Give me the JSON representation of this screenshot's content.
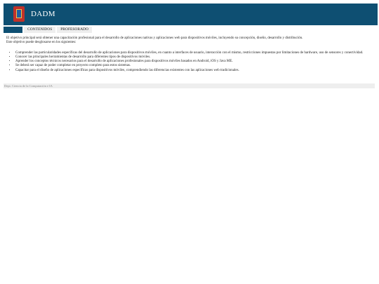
{
  "header": {
    "title": "DADM",
    "logo_icon": "university-shield-icon"
  },
  "nav": {
    "tabs": [
      {
        "label": "Inicio",
        "active": true
      },
      {
        "label": "Contenidos",
        "active": false
      },
      {
        "label": "Profesorado",
        "active": false
      }
    ]
  },
  "main": {
    "intro_1": "El objetivo principal será obtener una capacitación profesional para el desarrollo de aplicaciones nativas y aplicaciones web para dispositivos móviles, incluyendo su concepción, diseño, desarrollo y distribución.",
    "intro_2": "Este objetivo puede desglosarse en los siguientes:",
    "objectives": [
      "Comprender las particularidades específicas del desarrollo de aplicaciones para dispositivos móviles, en cuanto a interfaces de usuario, interacción con el mismo, restricciones impuestas por limitaciones de hardware, uso de sensores y conectividad.",
      "Conocer las principales herramientas de desarrollo para diferentes tipos de dispositivos móviles.",
      "Aprender los conceptos técnicos necesarios para el desarrollo de aplicaciones profesionales para dispositivos móviles basados en Android, iOS y Java ME.",
      "Se deberá ser capaz de poder completar en proyecto completo para estos sistemas.",
      "Capacitar para el diseño de aplicaciones específicas para dispositivos móviles, comprendiendo las diferencias existentes con las aplicaciones web tradicionales."
    ]
  },
  "footer": {
    "text": "Dept. Ciencia de la Computación e IA"
  },
  "colors": {
    "brand": "#0e4f72",
    "tab_bg": "#eeeeee"
  }
}
